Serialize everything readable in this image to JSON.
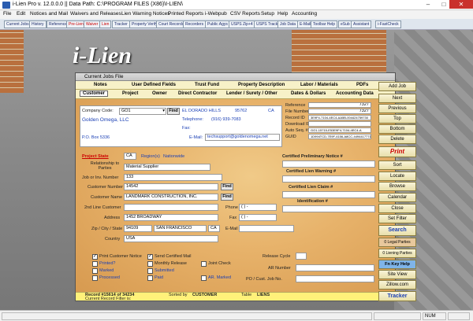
{
  "window": {
    "title": "i-Lien Pro v. 12.0.0.0  ||  Data Path: C:\\PROGRAM FILES (X86)\\I-LIEN\\"
  },
  "menu": [
    "File",
    "Edit",
    "Notices and Mail",
    "Waivers and Releases",
    "Lien Warning Notices",
    "Printed Reports",
    "i-Webpub",
    "CSV Reports",
    "Setup",
    "Help",
    "Accounting"
  ],
  "toolbar": [
    "Current Jobs",
    "History",
    "Reference",
    "Pre-Lien",
    "Waiver",
    "Lien",
    "Tracker",
    "Property Verify",
    "Court Records",
    "Recorders",
    "Public Agys",
    "USPS Zip+4",
    "USPS Track",
    "Job Data",
    "E-Mail",
    "Toolbar Help",
    "eSub",
    "Assistant",
    "i-FastCheck"
  ],
  "logo": "i-Lien",
  "form": {
    "title": "Current Jobs File",
    "tabs_row1": [
      "Notes",
      "User Defined Fields",
      "Trust Fund",
      "Property Description",
      "Labor / Materials",
      "PDFs"
    ],
    "tabs_row2": [
      "Customer",
      "Project",
      "Owner",
      "Direct Contractor",
      "Lender / Surety / Other",
      "Dates & Dollars",
      "Accounting Data"
    ],
    "company": {
      "code_label": "Company Code:",
      "code_value": "GO1",
      "find_label": "Find",
      "name": "Golden Omega, LLC",
      "city": "EL DORADO HILLS",
      "zip": "95762",
      "state": "CA",
      "telephone_label": "Telephone:",
      "telephone": "(916) 939-7083",
      "fax_label": "Fax:",
      "po_box": "P.O. Box 5336",
      "email_label": "E-Mail:",
      "email": "techsupport@goldenomega.net"
    },
    "info": {
      "reference_label": "Reference",
      "reference": "7327",
      "file_number_label": "File Number",
      "file_number": "7327",
      "record_id_label": "Record ID",
      "record_id": "3E9F4-7104-4EC4-AA5B-004424759730",
      "download_id_label": "Download ID",
      "download_id": "",
      "auto_seq_label": "Auto Seq. #",
      "auto_seq": "GO1-15715-E53E9F4-7104-4EC4-A",
      "guid_label": "GUID",
      "guid": "1D994TCD-7E9F-4156-A8CC-4494417771378"
    },
    "project_state_label": "Project State",
    "project_state": "CA",
    "regions_label": "Region(s)",
    "regions": "Nationwide",
    "relationship_label": "Relationship to Parties",
    "relationship": "Material Supplier",
    "job_label": "Job or Inv. Number",
    "job": "133",
    "cust_number_label": "Customer Number",
    "cust_number": "14542",
    "cust_name_label": "Customer Name",
    "cust_name": "LANDMARK CONSTRUCTION, INC.",
    "second_line_label": "2nd Line Customer",
    "second_line": "",
    "phone_label": "Phone",
    "phone": "(   )   -",
    "address_label": "Address",
    "address": "1452 BROADWAY",
    "fax_label": "Fax",
    "fax": "(   )   -",
    "csz_label": "Zip / City / State",
    "zip": "94109",
    "city": "SAN FRANCISCO",
    "state": "CA",
    "email_label": "E-Mail",
    "country_label": "Country",
    "country": "USA",
    "certified_prelim": "Certified Preliminary Notice #",
    "certified_warning": "Certified  Lien Warning #",
    "certified_claim": "Certified  Lien Claim #",
    "identification": "Identification #",
    "checks": {
      "print_customer_notice": "Print Customer Notice",
      "printed": "Printed?",
      "marked": "Marked",
      "processed": "Processed",
      "send_certified": "Send Certified Mail",
      "monthly_release": "Monthly Release",
      "submitted": "Submitted",
      "paid": "Paid",
      "joint_check": "Joint Check",
      "ar_marked": "AR. Marked"
    },
    "release_cycle_label": "Release Cycle",
    "ar_number_label": "AR Number",
    "po_label": "PO / Cust. Job No.",
    "footer": {
      "record": "Record #15614 of 34234",
      "sorted_by_label": "Sorted by",
      "sorted_by": "CUSTOMER",
      "table_label": "Table",
      "table": "LIENS",
      "filter": "Current Record Filter is:"
    }
  },
  "right_buttons": [
    "Add Job",
    "Next",
    "Previous",
    "Top",
    "Bottom",
    "Delete",
    "Print",
    "Sort",
    "Locate",
    "Browse",
    "Calendar",
    "Close",
    "Set Filter",
    "Search",
    "0 Legal Parties",
    "0 Liening Parties",
    "Fn Key Help",
    "Site View",
    "Zillow.com",
    "Tracker"
  ],
  "status": {
    "num": "NUM"
  }
}
